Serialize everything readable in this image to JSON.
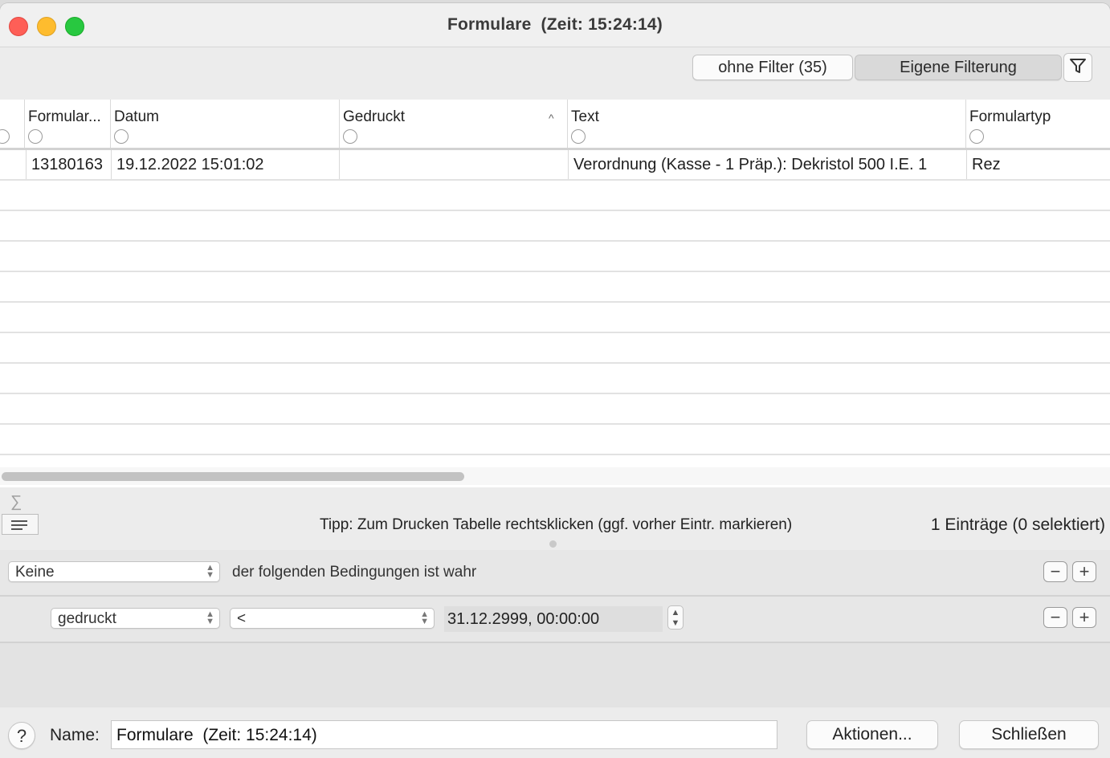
{
  "window": {
    "title": "Formulare  (Zeit: 15:24:14)"
  },
  "toolbar": {
    "filter_none_label": "ohne Filter (35)",
    "filter_custom_label": "Eigene Filterung",
    "filter_icon": "funnel-icon"
  },
  "table": {
    "columns": [
      {
        "label": "Formular..."
      },
      {
        "label": "Datum"
      },
      {
        "label": "Gedruckt"
      },
      {
        "label": "Text"
      },
      {
        "label": "Formulartyp"
      }
    ],
    "sorted_column": "Gedruckt",
    "rows": [
      {
        "formular": "13180163",
        "datum": "19.12.2022 15:01:02",
        "gedruckt": "",
        "text": "Verordnung (Kasse - 1 Präp.): Dekristol 500 I.E. 1",
        "formulartyp": "Rez"
      }
    ]
  },
  "status": {
    "sigma": "∑",
    "tip": "Tipp: Zum Drucken Tabelle rechtsklicken (ggf. vorher Eintr. markieren)",
    "count": "1 Einträge (0 selektiert)"
  },
  "predicate": {
    "compound_value": "Keine",
    "compound_text": "der folgenden Bedingungen ist wahr",
    "field_value": "gedruckt",
    "operator_value": "<",
    "date_value": "31.12.2999, 00:00:00",
    "minus": "−",
    "plus": "+"
  },
  "bottom": {
    "help": "?",
    "name_label": "Name:",
    "name_value": "Formulare  (Zeit: 15:24:14)",
    "actions_label": "Aktionen...",
    "close_label": "Schließen"
  },
  "colors": {
    "close": "#fe5f57",
    "minimize": "#febc2e",
    "zoom": "#28c840"
  }
}
